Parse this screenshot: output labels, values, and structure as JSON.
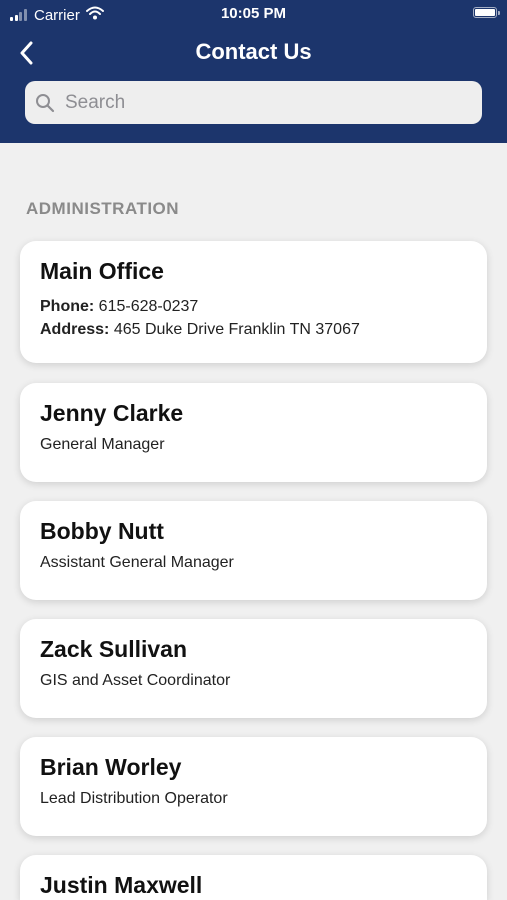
{
  "status_bar": {
    "carrier": "Carrier",
    "time": "10:05 PM",
    "battery_level": 1.0
  },
  "nav": {
    "title": "Contact Us",
    "back_icon": "chevron-left-icon"
  },
  "search": {
    "placeholder": "Search",
    "value": "",
    "icon": "search-icon"
  },
  "section": {
    "title": "ADMINISTRATION"
  },
  "main_office": {
    "name": "Main Office",
    "phone_label": "Phone:",
    "phone": "615-628-0237",
    "address_label": "Address:",
    "address": "465 Duke Drive Franklin TN 37067"
  },
  "contacts": [
    {
      "name": "Jenny Clarke",
      "title": "General Manager"
    },
    {
      "name": "Bobby Nutt",
      "title": "Assistant General Manager"
    },
    {
      "name": "Zack Sullivan",
      "title": "GIS and Asset Coordinator"
    },
    {
      "name": "Brian Worley",
      "title": "Lead Distribution Operator"
    },
    {
      "name": "Justin Maxwell",
      "title": ""
    }
  ],
  "colors": {
    "header": "#1c356c",
    "background": "#f0f0f0",
    "card": "#ffffff",
    "section_text": "#8a8a8a"
  }
}
